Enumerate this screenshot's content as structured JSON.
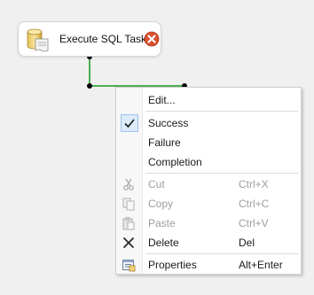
{
  "task": {
    "label": "Execute SQL Task",
    "icon": "database-script-icon",
    "status_icon": "error-icon",
    "status_color": "#d9502f"
  },
  "connector": {
    "color": "#4caf50",
    "endpoint_color": "#000000"
  },
  "context_menu": {
    "items": [
      {
        "label": "Edit...",
        "shortcut": "",
        "enabled": true,
        "icon": ""
      },
      {
        "label": "Success",
        "shortcut": "",
        "enabled": true,
        "checked": true,
        "icon": "checkmark-icon"
      },
      {
        "label": "Failure",
        "shortcut": "",
        "enabled": true,
        "icon": ""
      },
      {
        "label": "Completion",
        "shortcut": "",
        "enabled": true,
        "icon": ""
      },
      {
        "label": "Cut",
        "shortcut": "Ctrl+X",
        "enabled": false,
        "icon": "scissors-icon"
      },
      {
        "label": "Copy",
        "shortcut": "Ctrl+C",
        "enabled": false,
        "icon": "copy-icon"
      },
      {
        "label": "Paste",
        "shortcut": "Ctrl+V",
        "enabled": false,
        "icon": "paste-icon"
      },
      {
        "label": "Delete",
        "shortcut": "Del",
        "enabled": true,
        "icon": "delete-x-icon"
      },
      {
        "label": "Properties",
        "shortcut": "Alt+Enter",
        "enabled": true,
        "icon": "properties-icon"
      }
    ]
  }
}
